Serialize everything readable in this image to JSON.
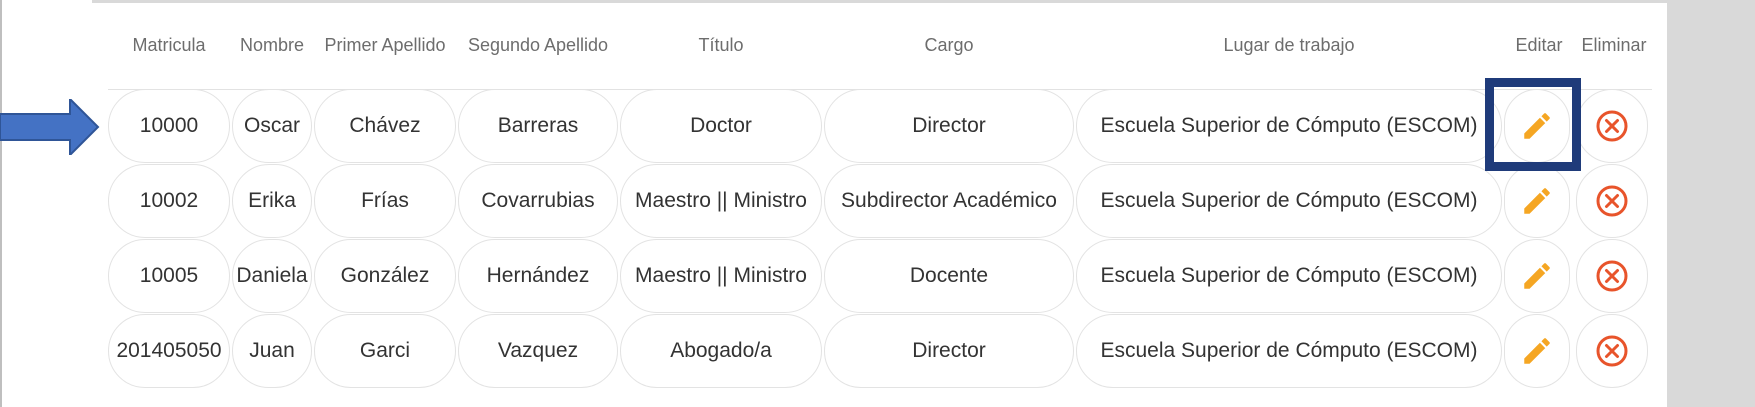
{
  "headers": {
    "matricula": "Matricula",
    "nombre": "Nombre",
    "primer_apellido": "Primer Apellido",
    "segundo_apellido": "Segundo Apellido",
    "titulo": "Título",
    "cargo": "Cargo",
    "lugar": "Lugar de trabajo",
    "editar": "Editar",
    "eliminar": "Eliminar"
  },
  "rows": [
    {
      "matricula": "10000",
      "nombre": "Oscar",
      "primer_apellido": "Chávez",
      "segundo_apellido": "Barreras",
      "titulo": "Doctor",
      "cargo": "Director",
      "lugar": "Escuela Superior de Cómputo (ESCOM)"
    },
    {
      "matricula": "10002",
      "nombre": "Erika",
      "primer_apellido": "Frías",
      "segundo_apellido": "Covarrubias",
      "titulo": "Maestro || Ministro",
      "cargo": "Subdirector Académico",
      "lugar": "Escuela Superior de Cómputo (ESCOM)"
    },
    {
      "matricula": "10005",
      "nombre": "Daniela",
      "primer_apellido": "González",
      "segundo_apellido": "Hernández",
      "titulo": "Maestro || Ministro",
      "cargo": "Docente",
      "lugar": "Escuela Superior de Cómputo (ESCOM)"
    },
    {
      "matricula": "201405050",
      "nombre": "Juan",
      "primer_apellido": "Garci",
      "segundo_apellido": "Vazquez",
      "titulo": "Abogado/a",
      "cargo": "Director",
      "lugar": "Escuela Superior de Cómputo (ESCOM)"
    }
  ],
  "icons": {
    "edit": "pencil-icon",
    "delete": "close-circle-icon"
  },
  "colors": {
    "edit_icon": "#f5a623",
    "delete_icon": "#e8542b",
    "highlight_box": "#1f3b7a",
    "arrow": "#4472c4"
  }
}
